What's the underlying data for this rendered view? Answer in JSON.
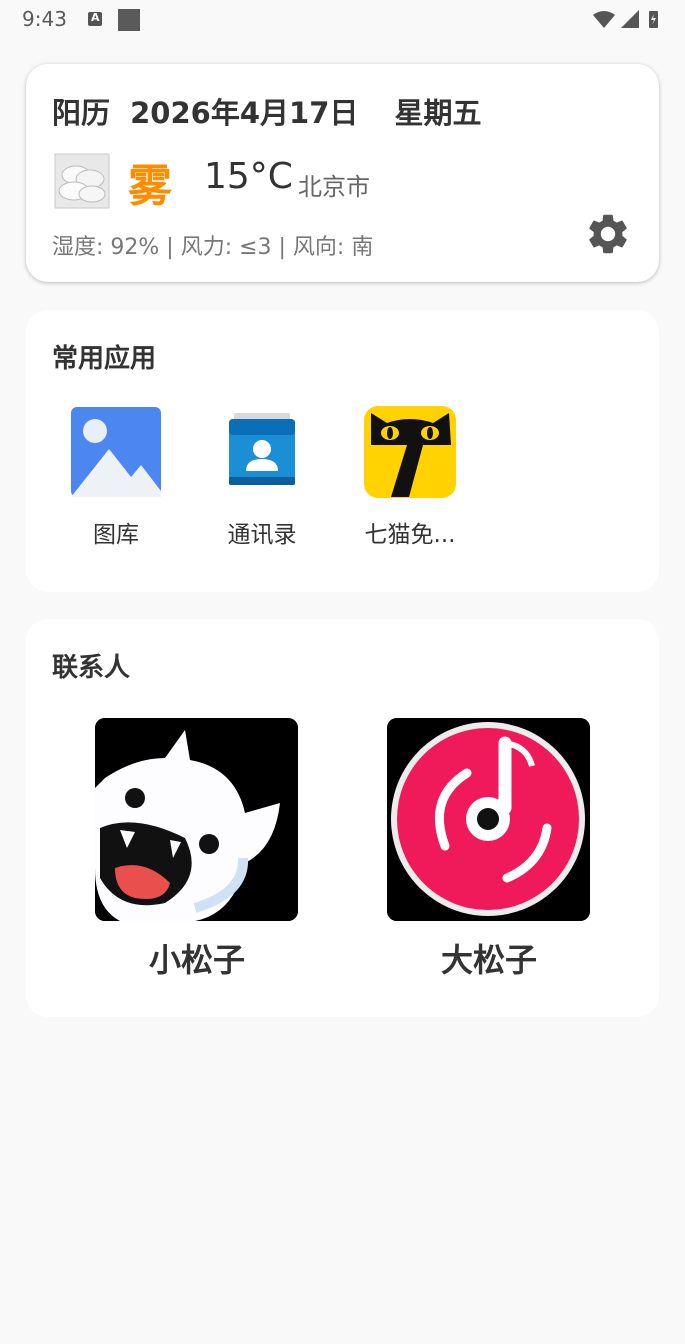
{
  "status_bar": {
    "time": "9:43",
    "notification_letter": "A"
  },
  "weather": {
    "calendar_label": "阳历",
    "date": "2026年4月17日",
    "weekday": "星期五",
    "condition": "雾",
    "temperature": "15°C",
    "city": "北京市",
    "detail": "湿度: 92% | 风力: ≤3 | 风向: 南",
    "condition_color": "#ff8c00"
  },
  "apps_section": {
    "title": "常用应用",
    "apps": [
      {
        "label": "图库",
        "icon": "gallery-icon"
      },
      {
        "label": "通讯录",
        "icon": "contacts-icon"
      },
      {
        "label": "七猫免...",
        "icon": "qimao-icon"
      }
    ]
  },
  "contacts_section": {
    "title": "联系人",
    "contacts": [
      {
        "name": "小松子",
        "avatar": "monster-avatar"
      },
      {
        "name": "大松子",
        "avatar": "music-disc-avatar"
      }
    ]
  }
}
